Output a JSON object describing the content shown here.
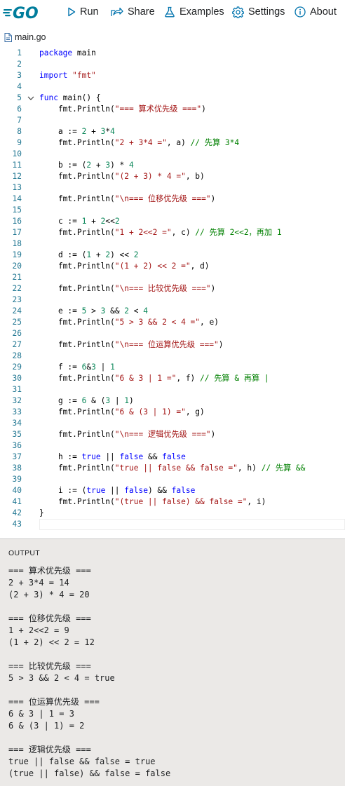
{
  "header": {
    "logo_text": "GO",
    "nav": [
      {
        "label": "Run",
        "icon": "play-icon"
      },
      {
        "label": "Share",
        "icon": "share-icon"
      },
      {
        "label": "Examples",
        "icon": "flask-icon"
      },
      {
        "label": "Settings",
        "icon": "gear-icon"
      },
      {
        "label": "About",
        "icon": "info-icon"
      }
    ]
  },
  "file_tab": {
    "name": "main.go"
  },
  "editor": {
    "current_line": 43,
    "lines": [
      {
        "n": "1",
        "code": "package main"
      },
      {
        "n": "2",
        "code": ""
      },
      {
        "n": "3",
        "code": "import \"fmt\""
      },
      {
        "n": "4",
        "code": ""
      },
      {
        "n": "5",
        "code": "func main() {"
      },
      {
        "n": "6",
        "code": "    fmt.Println(\"=== 算术优先级 ===\")"
      },
      {
        "n": "7",
        "code": ""
      },
      {
        "n": "8",
        "code": "    a := 2 + 3*4"
      },
      {
        "n": "9",
        "code": "    fmt.Println(\"2 + 3*4 =\", a) // 先算 3*4"
      },
      {
        "n": "10",
        "code": ""
      },
      {
        "n": "11",
        "code": "    b := (2 + 3) * 4"
      },
      {
        "n": "12",
        "code": "    fmt.Println(\"(2 + 3) * 4 =\", b)"
      },
      {
        "n": "13",
        "code": ""
      },
      {
        "n": "14",
        "code": "    fmt.Println(\"\\n=== 位移优先级 ===\")"
      },
      {
        "n": "15",
        "code": ""
      },
      {
        "n": "16",
        "code": "    c := 1 + 2<<2"
      },
      {
        "n": "17",
        "code": "    fmt.Println(\"1 + 2<<2 =\", c) // 先算 2<<2，再加 1"
      },
      {
        "n": "18",
        "code": ""
      },
      {
        "n": "19",
        "code": "    d := (1 + 2) << 2"
      },
      {
        "n": "20",
        "code": "    fmt.Println(\"(1 + 2) << 2 =\", d)"
      },
      {
        "n": "21",
        "code": ""
      },
      {
        "n": "22",
        "code": "    fmt.Println(\"\\n=== 比较优先级 ===\")"
      },
      {
        "n": "23",
        "code": ""
      },
      {
        "n": "24",
        "code": "    e := 5 > 3 && 2 < 4"
      },
      {
        "n": "25",
        "code": "    fmt.Println(\"5 > 3 && 2 < 4 =\", e)"
      },
      {
        "n": "26",
        "code": ""
      },
      {
        "n": "27",
        "code": "    fmt.Println(\"\\n=== 位运算优先级 ===\")"
      },
      {
        "n": "28",
        "code": ""
      },
      {
        "n": "29",
        "code": "    f := 6&3 | 1"
      },
      {
        "n": "30",
        "code": "    fmt.Println(\"6 & 3 | 1 =\", f) // 先算 & 再算 |"
      },
      {
        "n": "31",
        "code": ""
      },
      {
        "n": "32",
        "code": "    g := 6 & (3 | 1)"
      },
      {
        "n": "33",
        "code": "    fmt.Println(\"6 & (3 | 1) =\", g)"
      },
      {
        "n": "34",
        "code": ""
      },
      {
        "n": "35",
        "code": "    fmt.Println(\"\\n=== 逻辑优先级 ===\")"
      },
      {
        "n": "36",
        "code": ""
      },
      {
        "n": "37",
        "code": "    h := true || false && false"
      },
      {
        "n": "38",
        "code": "    fmt.Println(\"true || false && false =\", h) // 先算 &&"
      },
      {
        "n": "39",
        "code": ""
      },
      {
        "n": "40",
        "code": "    i := (true || false) && false"
      },
      {
        "n": "41",
        "code": "    fmt.Println(\"(true || false) && false =\", i)"
      },
      {
        "n": "42",
        "code": "}"
      },
      {
        "n": "43",
        "code": ""
      }
    ]
  },
  "output": {
    "label": "OUTPUT",
    "lines": [
      "=== 算术优先级 ===",
      "2 + 3*4 = 14",
      "(2 + 3) * 4 = 20",
      "",
      "=== 位移优先级 ===",
      "1 + 2<<2 = 9",
      "(1 + 2) << 2 = 12",
      "",
      "=== 比较优先级 ===",
      "5 > 3 && 2 < 4 = true",
      "",
      "=== 位运算优先级 ===",
      "6 & 3 | 1 = 3",
      "6 & (3 | 1) = 2",
      "",
      "=== 逻辑优先级 ===",
      "true || false && false = true",
      "(true || false) && false = false"
    ]
  },
  "colors": {
    "accent": "#007d9c",
    "line_number": "#237893",
    "keyword": "#0000ff",
    "string": "#a31515",
    "number": "#098658",
    "comment": "#008000",
    "output_bg": "#ebe9e7"
  }
}
